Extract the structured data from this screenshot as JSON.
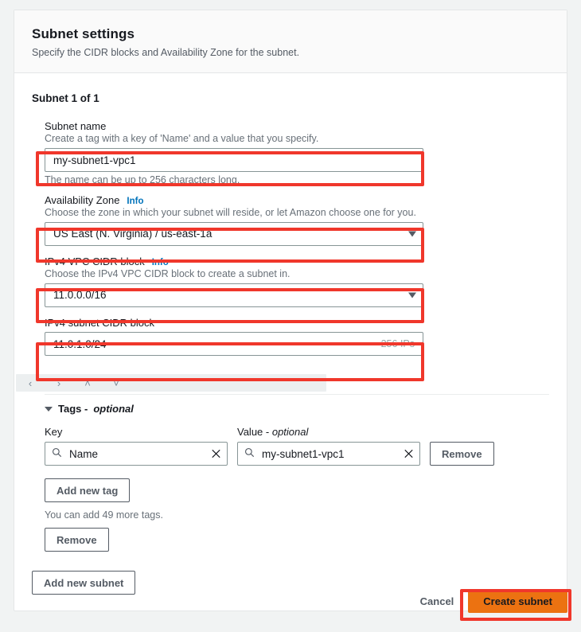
{
  "card": {
    "title": "Subnet settings",
    "subtitle": "Specify the CIDR blocks and Availability Zone for the subnet.",
    "subnet_index": "Subnet 1 of 1"
  },
  "fields": {
    "subnet_name": {
      "label": "Subnet name",
      "hint": "Create a tag with a key of 'Name' and a value that you specify.",
      "value": "my-subnet1-vpc1",
      "hint_after": "The name can be up to 256 characters long."
    },
    "availability_zone": {
      "label": "Availability Zone",
      "info": "Info",
      "hint": "Choose the zone in which your subnet will reside, or let Amazon choose one for you.",
      "value": "US East (N. Virginia) / us-east-1a"
    },
    "vpc_cidr": {
      "label": "IPv4 VPC CIDR block",
      "info": "Info",
      "hint": "Choose the IPv4 VPC CIDR block to create a subnet in.",
      "value": "11.0.0.0/16"
    },
    "subnet_cidr": {
      "label": "IPv4 subnet CIDR block",
      "value": "11.0.1.0/24",
      "ip_count": "256 IPs"
    }
  },
  "nav_strip": {
    "prev": "‹",
    "next": "›",
    "up": "˄",
    "down": "˅"
  },
  "tags": {
    "header": "Tags - ",
    "header_optional": "optional",
    "key_header": "Key",
    "value_header": "Value - ",
    "value_header_optional": "optional",
    "key_value": "Name",
    "value_value": "my-subnet1-vpc1",
    "remove_label": "Remove",
    "add_new_tag_label": "Add new tag",
    "add_more_note": "You can add 49 more tags.",
    "remove_block_label": "Remove"
  },
  "actions": {
    "add_new_subnet_label": "Add new subnet",
    "cancel_label": "Cancel",
    "create_label": "Create subnet"
  },
  "colors": {
    "primary": "#ec7211",
    "annotation": "#f0372b",
    "link": "#0073bb"
  }
}
